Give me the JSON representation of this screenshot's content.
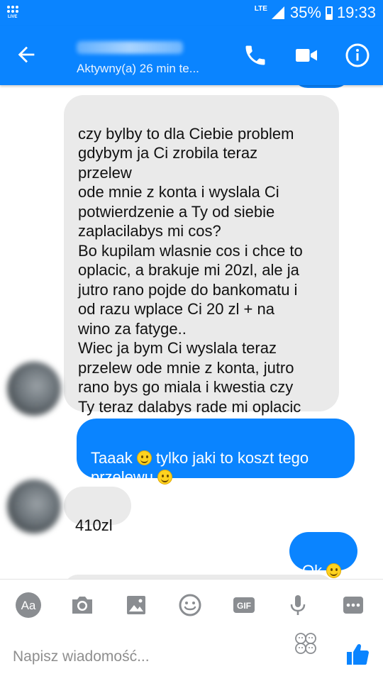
{
  "status_bar": {
    "live_label": "LIVE",
    "network": "LTE",
    "battery": "35%",
    "time": "19:33"
  },
  "header": {
    "contact_status": "Aktywny(a) 26 min te...",
    "icons": [
      "back-arrow-icon",
      "phone-icon",
      "video-camera-icon",
      "info-icon"
    ]
  },
  "messages": [
    {
      "direction": "incoming",
      "text": "czy bylby to dla Ciebie problem\ngdybym ja Ci zrobila teraz\nprzelew\node mnie z konta i wyslala Ci\npotwierdzenie a Ty od siebie\nzaplacilabys mi cos?\nBo kupilam wlasnie cos i chce to\noplacic, a brakuje mi 20zl, ale ja\njutro rano pojde do bankomatu i\nod razu wplace Ci 20 zl + na\nwino za fatyge..\nWiec ja bym Ci wyslala teraz\nprzelew ode mnie z konta, jutro\nrano bys go miala i kwestia czy\nTy teraz dalabys rade mi oplacic"
    },
    {
      "direction": "outgoing",
      "text_part1": "Taaak ",
      "text_part2": " tylko jaki to koszt tego\nprzelewu "
    },
    {
      "direction": "incoming",
      "text": "410zl"
    },
    {
      "direction": "outgoing",
      "text_part1": "Ok "
    }
  ],
  "composer": {
    "tools": [
      "text-format-icon",
      "camera-icon",
      "gallery-icon",
      "emoji-icon",
      "gif-icon",
      "microphone-icon",
      "more-icon"
    ],
    "aa_label": "Aa",
    "gif_label": "GIF",
    "placeholder": "Napisz wiadomość..."
  },
  "colors": {
    "brand_blue": "#0a84ff",
    "incoming_bubble": "#eaeaea",
    "tool_gray": "#8a8d91",
    "like_blue": "#0a84ff"
  }
}
